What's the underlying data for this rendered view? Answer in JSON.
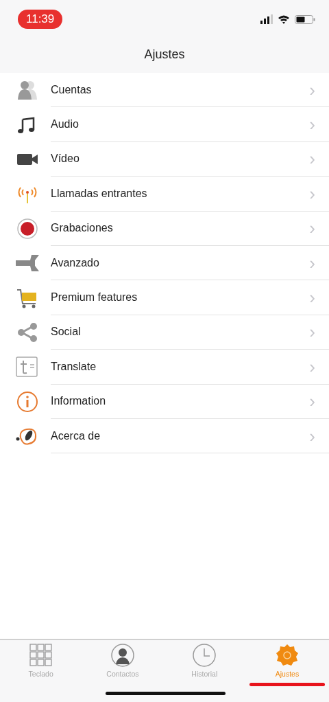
{
  "status_bar": {
    "time": "11:39"
  },
  "header": {
    "title": "Ajustes"
  },
  "settings": [
    {
      "label": "Cuentas",
      "chevron": "›"
    },
    {
      "label": "Audio",
      "chevron": "›"
    },
    {
      "label": "Vídeo",
      "chevron": "›"
    },
    {
      "label": "Llamadas entrantes",
      "chevron": "›"
    },
    {
      "label": "Grabaciones",
      "chevron": "›"
    },
    {
      "label": "Avanzado",
      "chevron": "›"
    },
    {
      "label": "Premium features",
      "chevron": "›"
    },
    {
      "label": "Social",
      "chevron": "›"
    },
    {
      "label": "Translate",
      "chevron": "›"
    },
    {
      "label": "Information",
      "chevron": "›"
    },
    {
      "label": "Acerca de",
      "chevron": "›"
    }
  ],
  "tab_bar": [
    {
      "label": "Teclado",
      "selected": false
    },
    {
      "label": "Contactos",
      "selected": false
    },
    {
      "label": "Historial",
      "selected": false
    },
    {
      "label": "Ajustes",
      "selected": true
    }
  ]
}
